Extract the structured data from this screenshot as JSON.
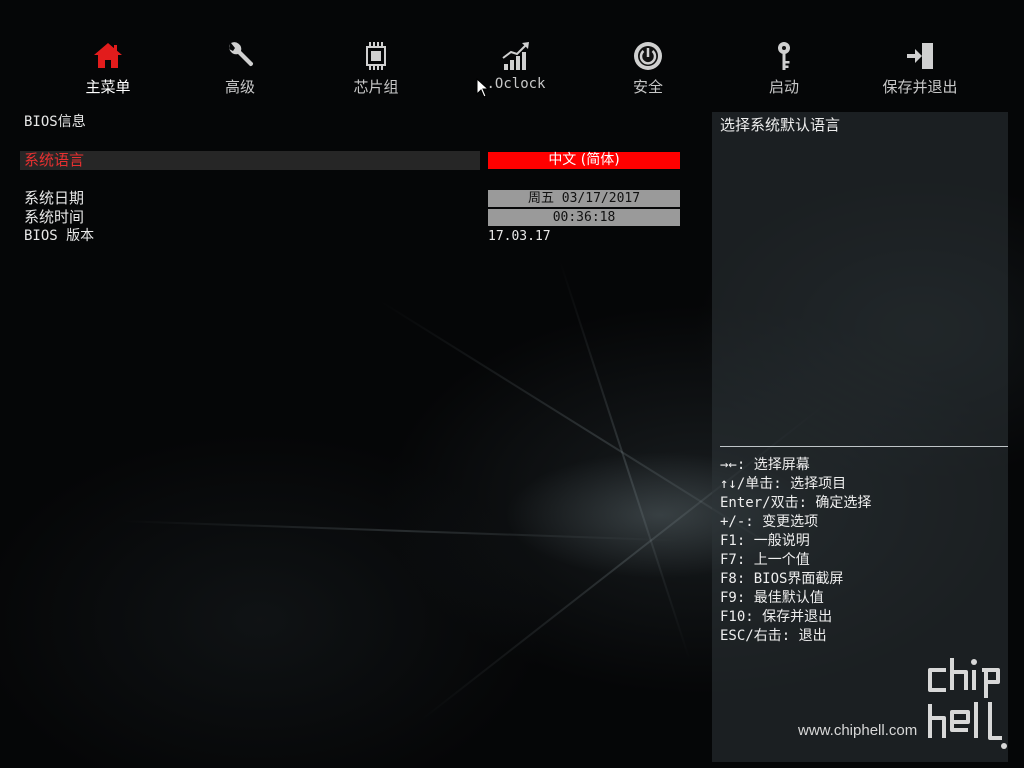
{
  "nav": {
    "items": [
      {
        "label": "主菜单",
        "icon": "home-icon",
        "active": true
      },
      {
        "label": "高级",
        "icon": "wrench-icon",
        "active": false
      },
      {
        "label": "芯片组",
        "icon": "chip-icon",
        "active": false
      },
      {
        "label": ".Oclock",
        "icon": "chart-up-icon",
        "active": false
      },
      {
        "label": "安全",
        "icon": "power-icon",
        "active": false
      },
      {
        "label": "启动",
        "icon": "key-icon",
        "active": false
      },
      {
        "label": "保存并退出",
        "icon": "exit-icon",
        "active": false
      }
    ]
  },
  "main": {
    "section_title": "BIOS信息",
    "language_label": "系统语言",
    "language_value": "中文 (简体)",
    "date_label": "系统日期",
    "date_value": "周五 03/17/2017",
    "time_label": "系统时间",
    "time_value": "00:36:18",
    "bios_version_label": "BIOS 版本",
    "bios_version_value": "17.03.17"
  },
  "help": {
    "description": "选择系统默认语言",
    "keys": [
      "→←: 选择屏幕",
      "↑↓/单击: 选择项目",
      "Enter/双击: 确定选择",
      "+/-: 变更选项",
      "F1: 一般说明",
      "F7: 上一个值",
      "F8: BIOS界面截屏",
      "F9: 最佳默认值",
      "F10: 保存并退出",
      "ESC/右击: 退出"
    ]
  },
  "watermark": "www.chiphell.com",
  "colors": {
    "accent": "#ff0000",
    "active_icon": "#e21c1c",
    "icon": "#d0d0d0",
    "value_bg": "#9a9a9a"
  }
}
